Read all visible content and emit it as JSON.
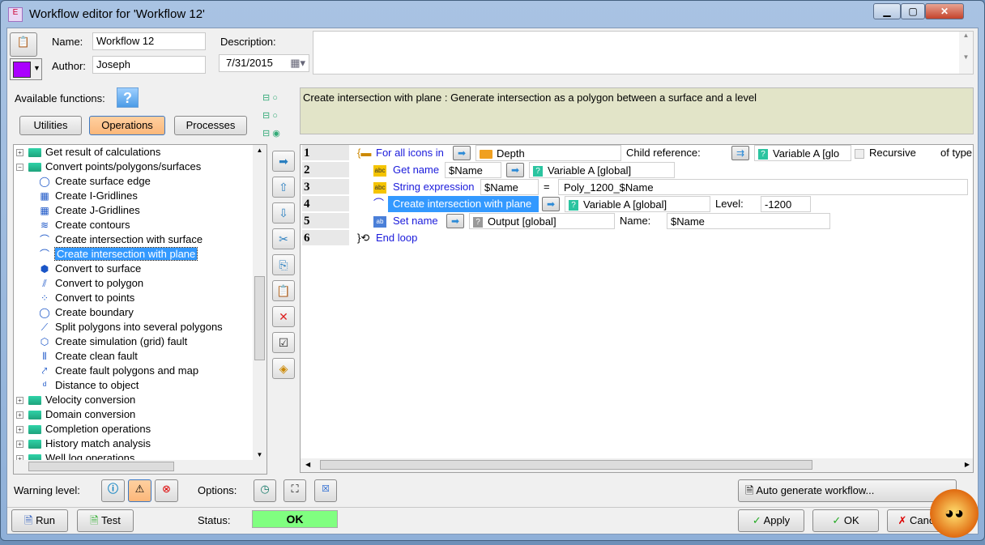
{
  "window": {
    "title": "Workflow editor for 'Workflow 12'",
    "controls": [
      "minimize",
      "maximize",
      "close"
    ]
  },
  "header": {
    "name_label": "Name:",
    "name_value": "Workflow 12",
    "author_label": "Author:",
    "author_value": "Joseph",
    "description_label": "Description:",
    "date_value": "7/31/2015",
    "color": "#aa00ff"
  },
  "functions": {
    "label": "Available functions:",
    "help": "?",
    "tabs": [
      "Utilities",
      "Operations",
      "Processes"
    ],
    "selected_tab": "Operations",
    "description": "Create intersection with plane : Generate intersection as a polygon between a surface and a level",
    "tree": [
      {
        "label": "Get result of calculations",
        "type": "folder",
        "level": 0
      },
      {
        "label": "Convert points/polygons/surfaces",
        "type": "folder-open",
        "level": 0
      },
      {
        "label": "Create surface edge",
        "level": 1
      },
      {
        "label": "Create I-Gridlines",
        "level": 1
      },
      {
        "label": "Create J-Gridlines",
        "level": 1
      },
      {
        "label": "Create contours",
        "level": 1
      },
      {
        "label": "Create intersection with surface",
        "level": 1
      },
      {
        "label": "Create intersection with plane",
        "level": 1,
        "selected": true
      },
      {
        "label": "Convert to surface",
        "level": 1
      },
      {
        "label": "Convert to polygon",
        "level": 1
      },
      {
        "label": "Convert to points",
        "level": 1
      },
      {
        "label": "Create boundary",
        "level": 1
      },
      {
        "label": "Split polygons into several polygons",
        "level": 1
      },
      {
        "label": "Create simulation (grid) fault",
        "level": 1
      },
      {
        "label": "Create clean fault",
        "level": 1
      },
      {
        "label": "Create fault polygons and map",
        "level": 1
      },
      {
        "label": "Distance to object",
        "level": 1
      },
      {
        "label": "Velocity conversion",
        "type": "folder",
        "level": 0
      },
      {
        "label": "Domain conversion",
        "type": "folder",
        "level": 0
      },
      {
        "label": "Completion operations",
        "type": "folder",
        "level": 0
      },
      {
        "label": "History match analysis",
        "type": "folder",
        "level": 0
      },
      {
        "label": "Well log operations",
        "type": "folder",
        "level": 0
      }
    ]
  },
  "steps": [
    {
      "n": "1",
      "label": "For all icons in",
      "input": "Depth",
      "extra_label": "Child reference:",
      "var": "Variable A [glo",
      "checkbox": "Recursive",
      "tail": "of type"
    },
    {
      "n": "2",
      "label": "Get name",
      "field": "$Name",
      "var": "Variable A [global]"
    },
    {
      "n": "3",
      "label": "String expression",
      "field": "$Name",
      "eq": "=",
      "expr": "Poly_1200_$Name"
    },
    {
      "n": "4",
      "label": "Create intersection with plane",
      "var": "Variable A [global]",
      "level_label": "Level:",
      "level_value": "-1200"
    },
    {
      "n": "5",
      "label": "Set name",
      "var": "Output [global]",
      "name_label": "Name:",
      "name_value": "$Name"
    },
    {
      "n": "6",
      "label": "End loop"
    }
  ],
  "footer": {
    "warning_label": "Warning level:",
    "options_label": "Options:",
    "auto_generate": "Auto generate workflow...",
    "run": "Run",
    "test": "Test",
    "status_label": "Status:",
    "status_value": "OK",
    "status_color": "#80ff80",
    "apply": "Apply",
    "ok": "OK",
    "cancel": "Cancel"
  }
}
